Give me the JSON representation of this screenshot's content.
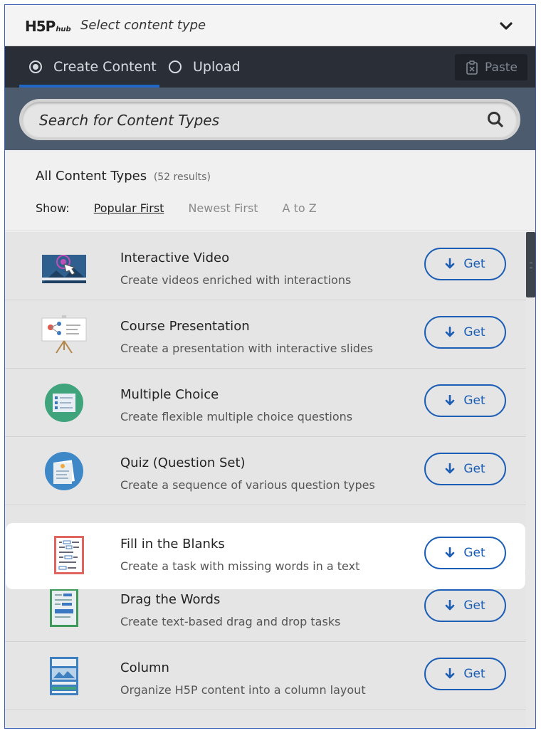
{
  "header": {
    "logo_text": "H5P",
    "logo_sub": "hub",
    "title": "Select content type"
  },
  "tabs": [
    {
      "label": "Create Content",
      "selected": true
    },
    {
      "label": "Upload",
      "selected": false
    }
  ],
  "paste": {
    "label": "Paste"
  },
  "search": {
    "placeholder": "Search for Content Types"
  },
  "filter": {
    "heading": "All Content Types",
    "results": "(52 results)",
    "show_label": "Show:",
    "sort_options": [
      "Popular First",
      "Newest First",
      "A to Z"
    ],
    "active_sort": "Popular First"
  },
  "content_types": [
    {
      "title": "Interactive Video",
      "description": "Create videos enriched with interactions",
      "button": "Get",
      "icon": "interactive-video-icon"
    },
    {
      "title": "Course Presentation",
      "description": "Create a presentation with interactive slides",
      "button": "Get",
      "icon": "course-presentation-icon"
    },
    {
      "title": "Multiple Choice",
      "description": "Create flexible multiple choice questions",
      "button": "Get",
      "icon": "multiple-choice-icon"
    },
    {
      "title": "Quiz (Question Set)",
      "description": "Create a sequence of various question types",
      "button": "Get",
      "icon": "question-set-icon"
    },
    {
      "title": "Fill in the Blanks",
      "description": "Create a task with missing words in a text",
      "button": "Get",
      "icon": "fill-in-blanks-icon",
      "highlighted": true
    },
    {
      "title": "Drag the Words",
      "description": "Create text-based drag and drop tasks",
      "button": "Get",
      "icon": "drag-the-words-icon"
    },
    {
      "title": "Column",
      "description": "Organize H5P content into a column layout",
      "button": "Get",
      "icon": "column-icon"
    }
  ],
  "colors": {
    "accent": "#1c5eb5",
    "tabbar": "#2a2f37",
    "search_band": "#4d5b6f"
  }
}
